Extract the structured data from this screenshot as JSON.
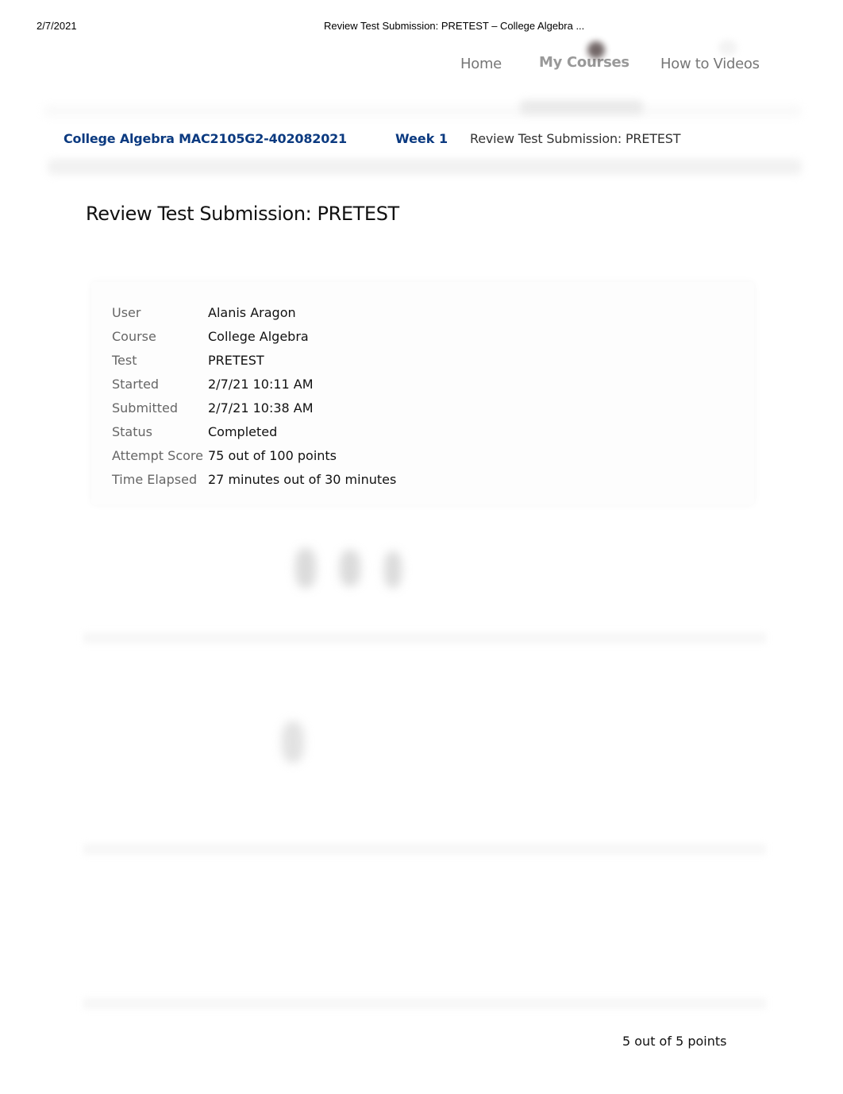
{
  "print_header": {
    "date": "2/7/2021",
    "title": "Review Test Submission: PRETEST – College Algebra ..."
  },
  "top_nav": {
    "items": [
      {
        "label": "Home"
      },
      {
        "label": "My Courses"
      },
      {
        "label": "How to Videos"
      }
    ]
  },
  "breadcrumb": {
    "course": "College Algebra MAC2105G2-402082021",
    "week": "Week 1",
    "current": "Review Test Submission: PRETEST"
  },
  "page": {
    "title": "Review Test Submission: PRETEST"
  },
  "summary": {
    "rows": [
      {
        "label": "User",
        "value": "Alanis Aragon"
      },
      {
        "label": "Course",
        "value": "College Algebra"
      },
      {
        "label": "Test",
        "value": "PRETEST"
      },
      {
        "label": "Started",
        "value": "2/7/21 10:11 AM"
      },
      {
        "label": "Submitted",
        "value": "2/7/21 10:38 AM"
      },
      {
        "label": "Status",
        "value": "Completed"
      },
      {
        "label": "Attempt Score",
        "value": "75 out of 100 points"
      },
      {
        "label": "Time Elapsed",
        "value": "27 minutes out of 30 minutes"
      }
    ]
  },
  "question": {
    "points": "5 out of 5 points"
  },
  "colors": {
    "link_blue": "#0b3a80",
    "nav_gray": "#777777",
    "label_gray": "#666666"
  }
}
